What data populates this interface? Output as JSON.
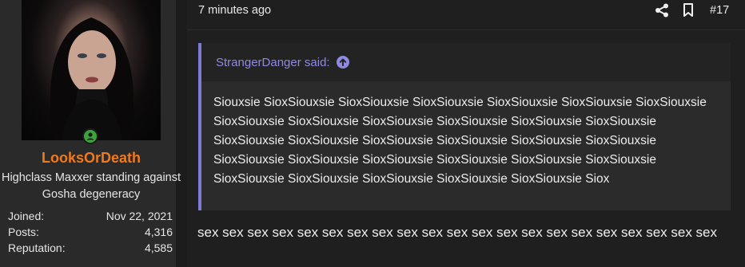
{
  "user": {
    "username": "LooksOrDeath",
    "title": "Highclass Maxxer standing against Gosha degeneracy",
    "stats": [
      {
        "label": "Joined:",
        "value": "Nov 22, 2021"
      },
      {
        "label": "Posts:",
        "value": "4,316"
      },
      {
        "label": "Reputation:",
        "value": "4,585"
      }
    ],
    "online": true
  },
  "post": {
    "timestamp": "7 minutes ago",
    "number": "#17",
    "quote": {
      "author_said": "StrangerDanger said:",
      "text": "Siouxsie SioxSiouxsie SioxSiouxsie SioxSiouxsie SioxSiouxsie SioxSiouxsie SioxSiouxsie SioxSiouxsie SioxSiouxsie SioxSiouxsie SioxSiouxsie SioxSiouxsie SioxSiouxsie SioxSiouxsie SioxSiouxsie SioxSiouxsie SioxSiouxsie SioxSiouxsie SioxSiouxsie SioxSiouxsie SioxSiouxsie SioxSiouxsie SioxSiouxsie SioxSiouxsie SioxSiouxsie SioxSiouxsie SioxSiouxsie SioxSiouxsie SioxSiouxsie SioxSiouxsie Siox"
    },
    "message": "sex sex sex sex sex sex sex sex sex sex sex sex sex sex sex sex sex sex sex sex sex"
  },
  "icons": {
    "share": "share-icon",
    "bookmark": "bookmark-icon",
    "quote_arrow": "arrow-up-circle-icon",
    "online": "user-online-icon"
  },
  "colors": {
    "username": "#f07a1a",
    "quote_accent": "#7f7ad3",
    "online": "#3aa63a"
  }
}
